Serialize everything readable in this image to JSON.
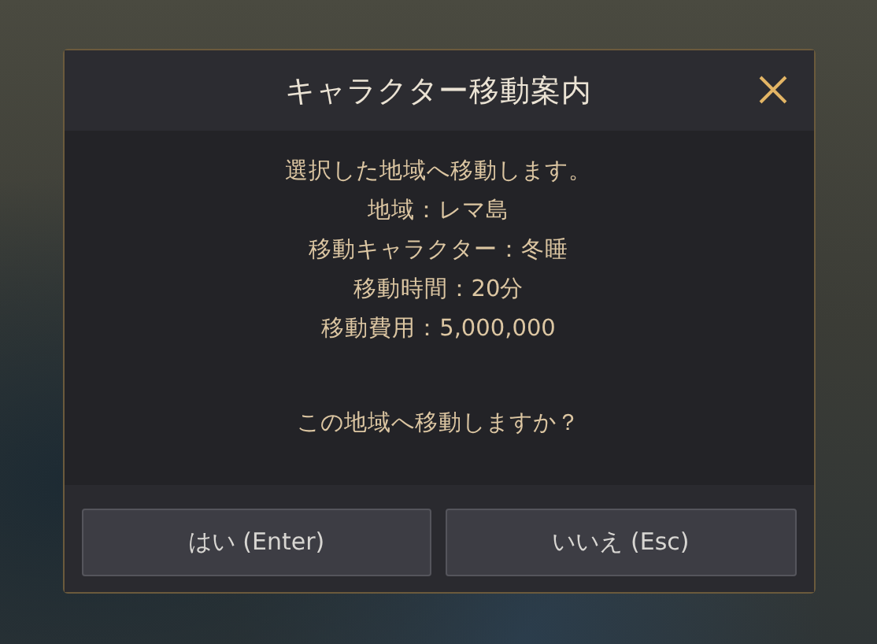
{
  "dialog": {
    "title": "キャラクター移動案内",
    "lines": [
      "選択した地域へ移動します。",
      "地域：レマ島",
      "移動キャラクター：冬睡",
      "移動時間：20分",
      "移動費用：5,000,000"
    ],
    "question": "この地域へ移動しますか？",
    "buttons": [
      {
        "label": "はい (Enter)"
      },
      {
        "label": "いいえ (Esc)"
      }
    ]
  }
}
